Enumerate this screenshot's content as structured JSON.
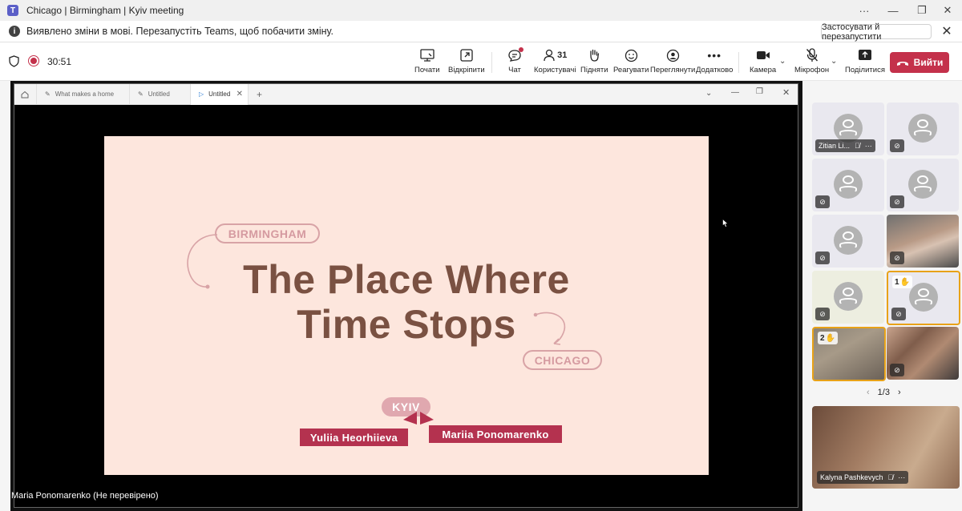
{
  "window": {
    "title": "Chicago | Birmingham | Kyiv meeting",
    "logo": "T"
  },
  "notification": {
    "message": "Виявлено зміни в мові. Перезапустіть Teams, щоб побачити зміну.",
    "apply_button": "Застосувати й перезапустити"
  },
  "toolbar": {
    "timer": "30:51",
    "items": [
      {
        "label": "Почати",
        "icon": "whiteboard-icon"
      },
      {
        "label": "Відкріпити",
        "icon": "popout-icon"
      },
      {
        "label": "Чат",
        "icon": "chat-icon"
      },
      {
        "label": "Користувачі",
        "icon": "people-icon",
        "count": "31"
      },
      {
        "label": "Підняти",
        "icon": "raise-hand-icon"
      },
      {
        "label": "Реагувати",
        "icon": "react-icon"
      },
      {
        "label": "Переглянути",
        "icon": "view-icon"
      },
      {
        "label": "Додатково",
        "icon": "more-icon"
      },
      {
        "label": "Камера",
        "icon": "camera-icon"
      },
      {
        "label": "Мікрофон",
        "icon": "mic-off-icon"
      },
      {
        "label": "Поділитися",
        "icon": "share-icon"
      }
    ],
    "leave_label": "Вийти"
  },
  "share": {
    "tabs": [
      "What makes a home",
      "Untitled",
      "Untitled"
    ],
    "slide": {
      "pill_top": "BIRMINGHAM",
      "title_line1": "The Place Where",
      "title_line2": "Time Stops",
      "pill_right": "CHICAGO",
      "pill_bottom": "KYIV",
      "name_left": "Yuliia Heorhiieva",
      "name_right": "Mariia Ponomarenko"
    },
    "presenter": "Maria Ponomarenko (Не перевірено)"
  },
  "participants": {
    "tile1_name": "Zitian Li...",
    "hand1": "1",
    "hand2": "2",
    "pager": "1/3",
    "self_name": "Kalyna Pashkevych"
  },
  "colors": {
    "leave": "#c4314b",
    "slide_bg": "#fde6dd",
    "slide_title": "#7a5142",
    "name_tag": "#b4324f",
    "highlight": "#e8a218"
  }
}
